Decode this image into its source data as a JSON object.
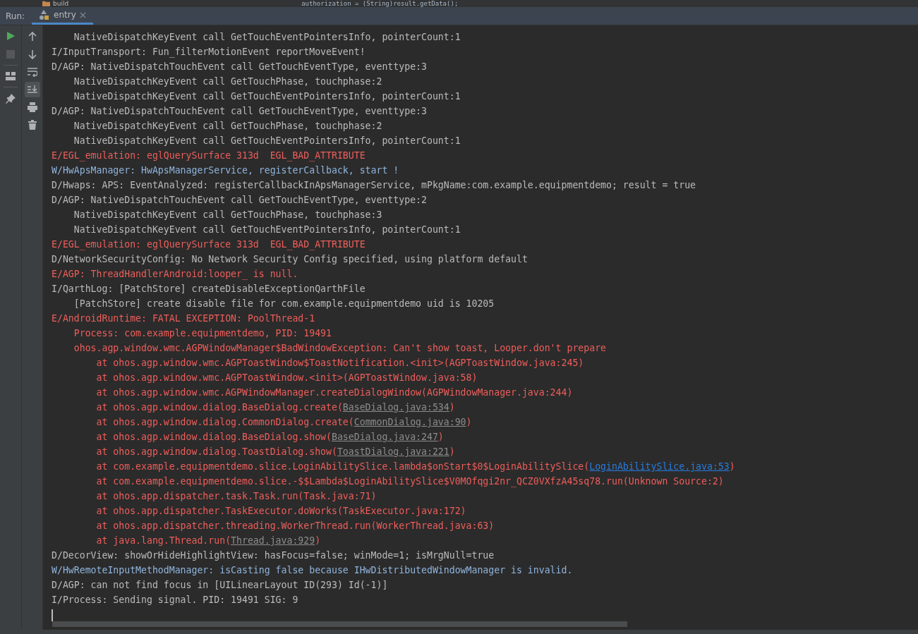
{
  "editor_strip": {
    "folder": "build",
    "code": "authorization = (String)result.getData();"
  },
  "run_bar": {
    "label": "Run:",
    "tabs": [
      {
        "label": "entry",
        "selected": true
      }
    ]
  },
  "toolbar": [
    {
      "kind": "run"
    },
    {
      "kind": "stop",
      "disabled": true
    },
    {
      "kind": "layout"
    },
    {
      "kind": "pin"
    }
  ],
  "console_tools": [
    {
      "kind": "up",
      "selected": false
    },
    {
      "kind": "down",
      "selected": false
    },
    {
      "kind": "wrap",
      "selected": false
    },
    {
      "kind": "scroll-end",
      "selected": true
    },
    {
      "kind": "print",
      "selected": false
    },
    {
      "kind": "trash",
      "selected": false
    }
  ],
  "log": [
    {
      "kind": "debug",
      "text": "    NativeDispatchKeyEvent call GetTouchEventPointersInfo, pointerCount:1"
    },
    {
      "kind": "info",
      "text": "I/InputTransport: Fun_filterMotionEvent reportMoveEvent!"
    },
    {
      "kind": "debug",
      "text": "D/AGP: NativeDispatchTouchEvent call GetTouchEventType, eventtype:3"
    },
    {
      "kind": "debug",
      "text": "    NativeDispatchKeyEvent call GetTouchPhase, touchphase:2"
    },
    {
      "kind": "debug",
      "text": "    NativeDispatchKeyEvent call GetTouchEventPointersInfo, pointerCount:1"
    },
    {
      "kind": "debug",
      "text": "D/AGP: NativeDispatchTouchEvent call GetTouchEventType, eventtype:3"
    },
    {
      "kind": "debug",
      "text": "    NativeDispatchKeyEvent call GetTouchPhase, touchphase:2"
    },
    {
      "kind": "debug",
      "text": "    NativeDispatchKeyEvent call GetTouchEventPointersInfo, pointerCount:1"
    },
    {
      "kind": "error",
      "text": "E/EGL_emulation: eglQuerySurface 313d  EGL_BAD_ATTRIBUTE"
    },
    {
      "kind": "warning",
      "text": "W/HwApsManager: HwApsManagerService, registerCallback, start !"
    },
    {
      "kind": "debug",
      "text": "D/Hwaps: APS: EventAnalyzed: registerCallbackInApsManagerService, mPkgName:com.example.equipmentdemo; result = true"
    },
    {
      "kind": "debug",
      "text": "D/AGP: NativeDispatchTouchEvent call GetTouchEventType, eventtype:2"
    },
    {
      "kind": "debug",
      "text": "    NativeDispatchKeyEvent call GetTouchPhase, touchphase:3"
    },
    {
      "kind": "debug",
      "text": "    NativeDispatchKeyEvent call GetTouchEventPointersInfo, pointerCount:1"
    },
    {
      "kind": "error",
      "text": "E/EGL_emulation: eglQuerySurface 313d  EGL_BAD_ATTRIBUTE"
    },
    {
      "kind": "debug",
      "text": "D/NetworkSecurityConfig: No Network Security Config specified, using platform default"
    },
    {
      "kind": "error",
      "text": "E/AGP: ThreadHandlerAndroid:looper_ is null."
    },
    {
      "kind": "info",
      "text": "I/QarthLog: [PatchStore] createDisableExceptionQarthFile"
    },
    {
      "kind": "info",
      "text": "    [PatchStore] create disable file for com.example.equipmentdemo uid is 10205"
    },
    {
      "kind": "error",
      "text": "E/AndroidRuntime: FATAL EXCEPTION: PoolThread-1"
    },
    {
      "kind": "error",
      "text": "    Process: com.example.equipmentdemo, PID: 19491"
    },
    {
      "kind": "error",
      "text": "    ohos.agp.window.wmc.AGPWindowManager$BadWindowException: Can't show toast, Looper.don't prepare"
    },
    {
      "kind": "error",
      "text": "        at ohos.agp.window.wmc.AGPToastWindow$ToastNotification.<init>(AGPToastWindow.java:245)"
    },
    {
      "kind": "error",
      "text": "        at ohos.agp.window.wmc.AGPToastWindow.<init>(AGPToastWindow.java:58)"
    },
    {
      "kind": "error",
      "text": "        at ohos.agp.window.wmc.AGPWindowManager.createDialogWindow(AGPWindowManager.java:244)"
    },
    {
      "kind": "error",
      "text": "        at ohos.agp.window.dialog.BaseDialog.create(",
      "link": "BaseDialog.java:534",
      "after": ")",
      "in_project": false
    },
    {
      "kind": "error",
      "text": "        at ohos.agp.window.dialog.CommonDialog.create(",
      "link": "CommonDialog.java:90",
      "after": ")",
      "in_project": false
    },
    {
      "kind": "error",
      "text": "        at ohos.agp.window.dialog.BaseDialog.show(",
      "link": "BaseDialog.java:247",
      "after": ")",
      "in_project": false
    },
    {
      "kind": "error",
      "text": "        at ohos.agp.window.dialog.ToastDialog.show(",
      "link": "ToastDialog.java:221",
      "after": ")",
      "in_project": false
    },
    {
      "kind": "error",
      "text": "        at com.example.equipmentdemo.slice.LoginAbilitySlice.lambda$onStart$0$LoginAbilitySlice(",
      "link": "LoginAbilitySlice.java:53",
      "after": ")",
      "in_project": true
    },
    {
      "kind": "error",
      "text": "        at com.example.equipmentdemo.slice.-$$Lambda$LoginAbilitySlice$V0MOfqgi2nr_QCZ0VXfzA45sq78.run(Unknown Source:2)"
    },
    {
      "kind": "error",
      "text": "        at ohos.app.dispatcher.task.Task.run(Task.java:71)"
    },
    {
      "kind": "error",
      "text": "        at ohos.app.dispatcher.TaskExecutor.doWorks(TaskExecutor.java:172)"
    },
    {
      "kind": "error",
      "text": "        at ohos.app.dispatcher.threading.WorkerThread.run(WorkerThread.java:63)"
    },
    {
      "kind": "error",
      "text": "        at java.lang.Thread.run(",
      "link": "Thread.java:929",
      "after": ")",
      "in_project": false
    },
    {
      "kind": "debug",
      "text": "D/DecorView: showOrHideHighlightView: hasFocus=false; winMode=1; isMrgNull=true"
    },
    {
      "kind": "warning",
      "text": "W/HwRemoteInputMethodManager: isCasting false because IHwDistributedWindowManager is invalid."
    },
    {
      "kind": "debug",
      "text": "D/AGP: can not find focus in [UILinearLayout ID(293) Id(-1)]"
    },
    {
      "kind": "info",
      "text": "I/Process: Sending signal. PID: 19491 SIG: 9"
    }
  ]
}
